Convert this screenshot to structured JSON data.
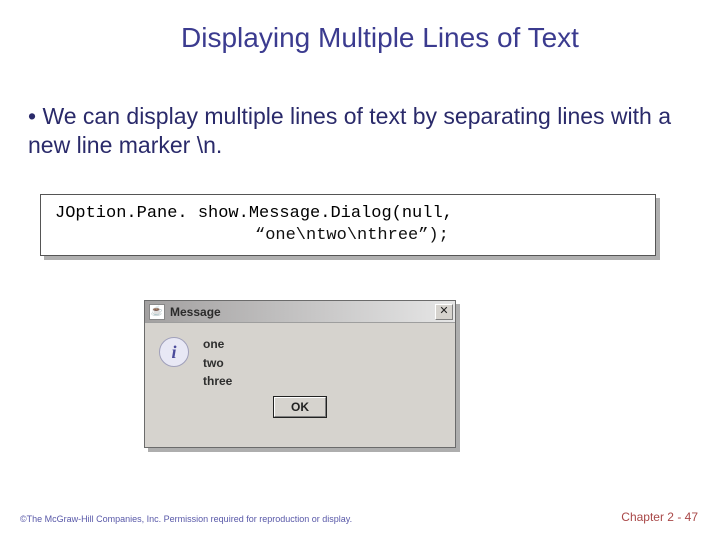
{
  "title": "Displaying Multiple Lines of Text",
  "bullet": "We can display multiple lines of text by separating lines with a new line marker \\n.",
  "code": {
    "line1": "JOption.Pane. show.Message.Dialog(null,",
    "line2": "“one\\ntwo\\nthree”);"
  },
  "dialog": {
    "titlebar_text": "Message",
    "close_glyph": "✕",
    "info_glyph": "i",
    "lines": {
      "l1": "one",
      "l2": "two",
      "l3": "three"
    },
    "ok_label": "OK",
    "java_icon_glyph": "☕"
  },
  "footer": {
    "copyright": "©The McGraw-Hill Companies, Inc. Permission required for reproduction or display.",
    "chapter": "Chapter 2 - 47"
  }
}
